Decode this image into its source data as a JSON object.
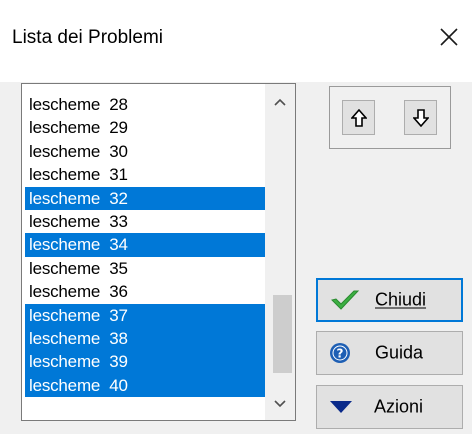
{
  "window": {
    "title": "Lista dei Problemi",
    "close_icon": "close-icon"
  },
  "list": {
    "items": [
      {
        "label": "lescheme  28",
        "selected": false
      },
      {
        "label": "lescheme  29",
        "selected": false
      },
      {
        "label": "lescheme  30",
        "selected": false
      },
      {
        "label": "lescheme  31",
        "selected": false
      },
      {
        "label": "lescheme  32",
        "selected": true
      },
      {
        "label": "lescheme  33",
        "selected": false
      },
      {
        "label": "lescheme  34",
        "selected": true
      },
      {
        "label": "lescheme  35",
        "selected": false
      },
      {
        "label": "lescheme  36",
        "selected": false
      },
      {
        "label": "lescheme  37",
        "selected": true
      },
      {
        "label": "lescheme  38",
        "selected": true
      },
      {
        "label": "lescheme  39",
        "selected": true
      },
      {
        "label": "lescheme  40",
        "selected": true
      }
    ],
    "selection_color": "#0078d7"
  },
  "arrows": {
    "up_icon": "arrow-up-icon",
    "down_icon": "arrow-down-icon"
  },
  "buttons": {
    "chiudi": {
      "label": "Chiudi",
      "icon": "checkmark-icon",
      "icon_color": "#3cb043"
    },
    "guida": {
      "label": "Guida",
      "icon": "help-icon",
      "icon_color": "#1e5fb4"
    },
    "azioni": {
      "label": "Azioni",
      "icon": "triangle-down-icon",
      "icon_color": "#0a2a8a"
    }
  }
}
